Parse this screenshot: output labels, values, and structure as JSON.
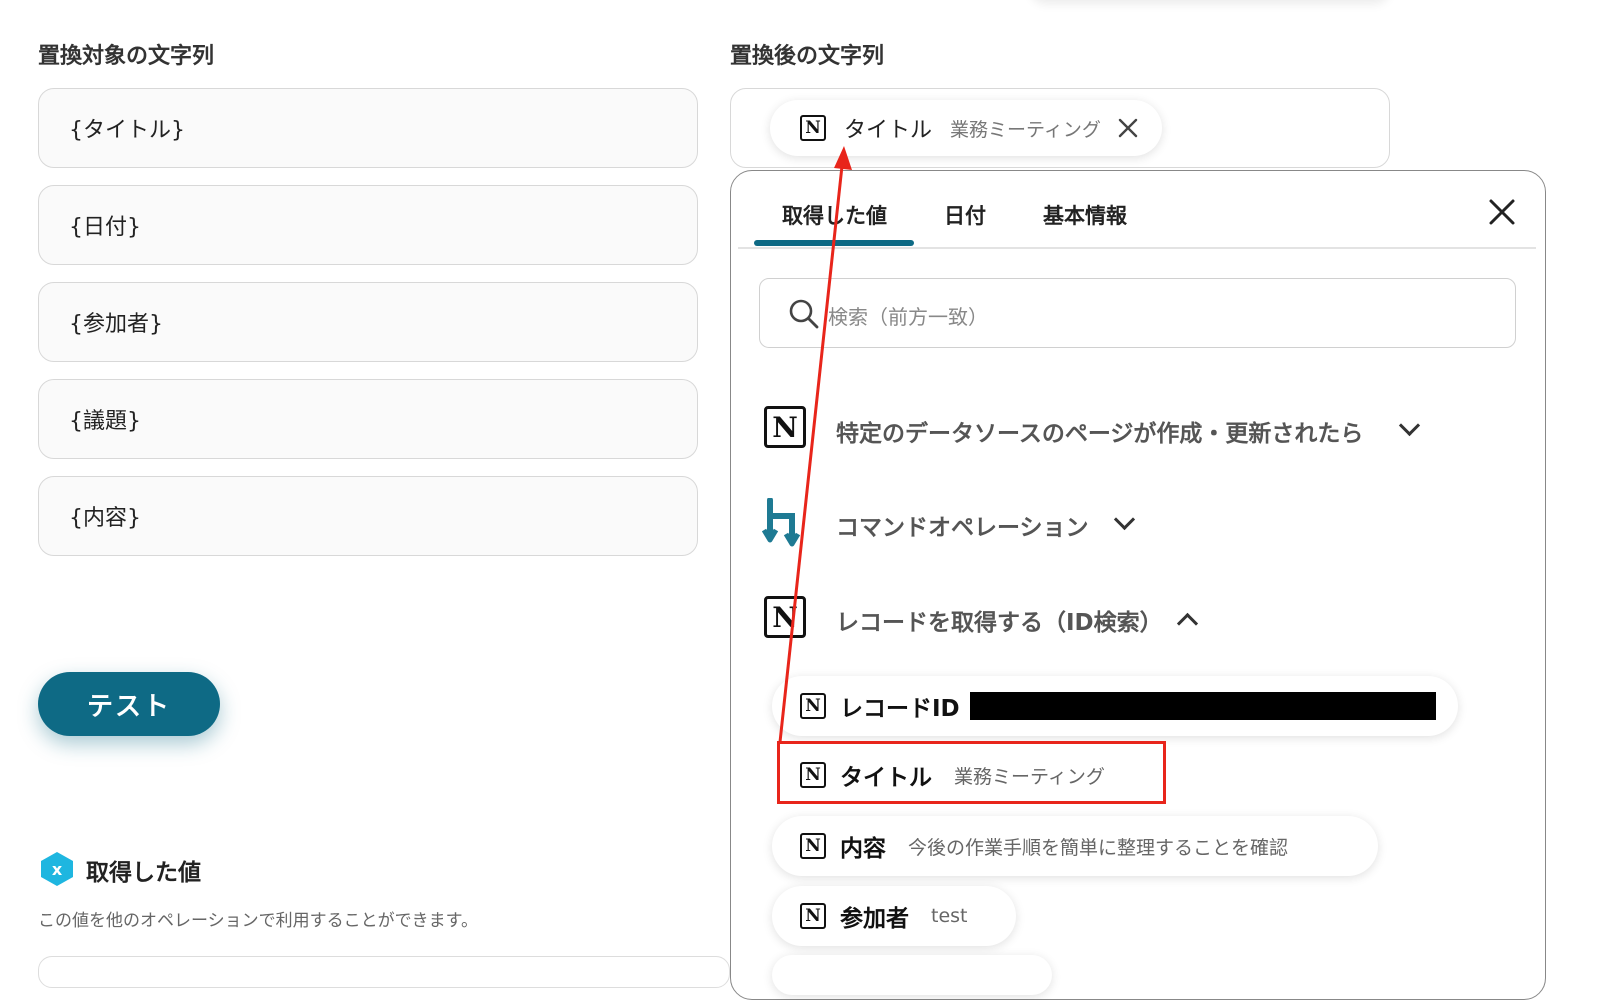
{
  "left": {
    "target_label": "置換対象の文字列",
    "fields": [
      "{タイトル}",
      "{日付}",
      "{参加者}",
      "{議題}",
      "{内容}"
    ],
    "test_button": "テスト",
    "obtained_title": "取得した値",
    "obtained_desc": "この値を他のオペレーションで利用することができます。"
  },
  "right": {
    "replace_label": "置換後の文字列",
    "selected_chip": {
      "key": "タイトル",
      "value": "業務ミーティング"
    }
  },
  "panel": {
    "tabs": [
      "取得した値",
      "日付",
      "基本情報"
    ],
    "active_tab": 0,
    "search_placeholder": "検索（前方一致）",
    "sections": [
      {
        "title": "特定のデータソースのページが作成・更新されたら",
        "expanded": false,
        "icon": "notion-icon"
      },
      {
        "title": "コマンドオペレーション",
        "expanded": false,
        "icon": "yoom-command-icon"
      },
      {
        "title": "レコードを取得する（ID検索）",
        "expanded": true,
        "icon": "notion-icon"
      }
    ],
    "items": [
      {
        "key": "レコードID",
        "value": "",
        "redacted": true
      },
      {
        "key": "タイトル",
        "value": "業務ミーティング",
        "highlighted": true
      },
      {
        "key": "内容",
        "value": "今後の作業手順を簡単に整理することを確認"
      },
      {
        "key": "参加者",
        "value": "test"
      }
    ]
  },
  "colors": {
    "primary": "#0e6a85",
    "annotation": "#e8251b",
    "yoom_accent": "#1eb6e0"
  }
}
